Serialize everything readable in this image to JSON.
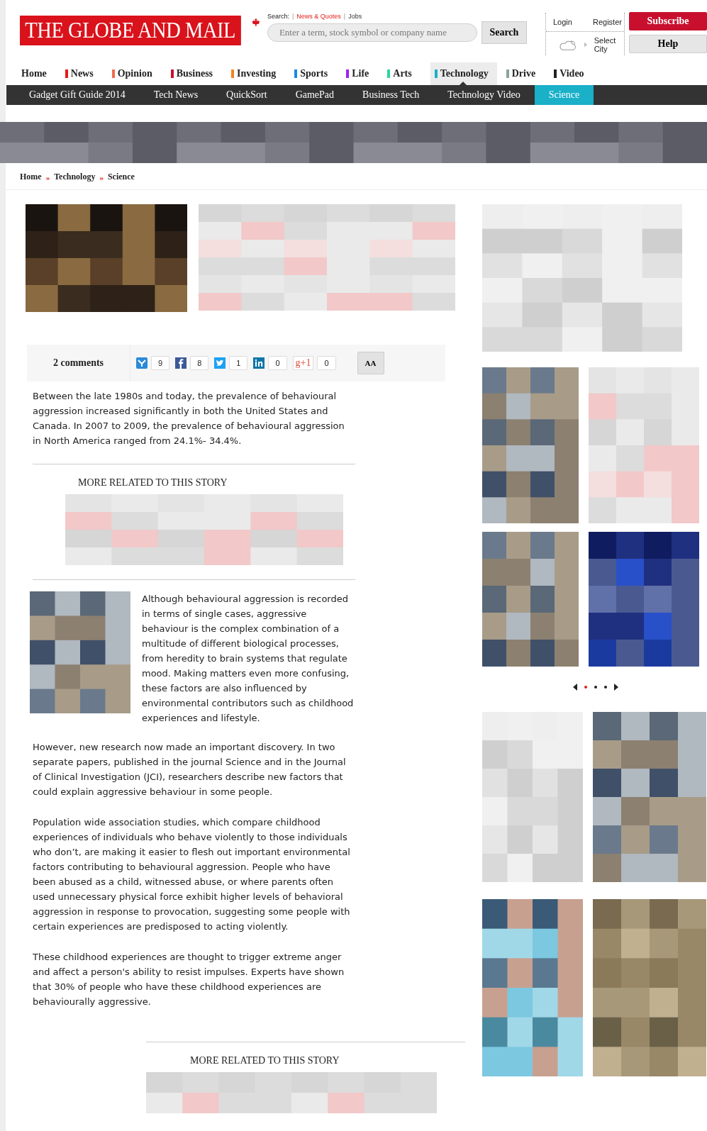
{
  "header": {
    "logo": "THE GLOBE AND MAIL",
    "search_label": "Search:",
    "search_links": [
      {
        "separator": "|",
        "label": "News & Quotes",
        "selected": true
      },
      {
        "separator": "|",
        "label": "Jobs",
        "selected": false
      }
    ],
    "search_field": {
      "placeholder": "Enter a term, stock symbol or company name"
    },
    "search_button": "Search",
    "login": "Login",
    "register": "Register",
    "city": "Select City",
    "subscribe": "Subscribe",
    "help": "Help"
  },
  "nav": [
    {
      "label": "Home",
      "selected": false
    },
    {
      "label": "News",
      "color": "#e41b17",
      "selected": false
    },
    {
      "label": "Opinion",
      "color": "#f26b4f",
      "selected": false
    },
    {
      "label": "Business",
      "color": "#c8102e",
      "selected": false
    },
    {
      "label": "Investing",
      "color": "#f58220",
      "selected": false
    },
    {
      "label": "Sports",
      "color": "#1e88e5",
      "selected": false
    },
    {
      "label": "Life",
      "color": "#a020f0",
      "selected": false
    },
    {
      "label": "Arts",
      "color": "#2ed3a0",
      "selected": false
    },
    {
      "label": "Technology",
      "color": "#1ab0c8",
      "selected": true
    },
    {
      "label": "Drive",
      "color": "#8aa59a",
      "selected": false
    },
    {
      "label": "Video",
      "color": "#222222",
      "selected": false
    }
  ],
  "subnav": [
    {
      "label": "Gadget Gift Guide 2014",
      "selected": false
    },
    {
      "label": "Tech News",
      "selected": false
    },
    {
      "label": "QuickSort",
      "selected": false
    },
    {
      "label": "GamePad",
      "selected": false
    },
    {
      "label": "Business Tech",
      "selected": false
    },
    {
      "label": "Technology Video",
      "selected": false
    },
    {
      "label": "Science",
      "selected": true
    }
  ],
  "breadcrumb": [
    {
      "label": "Home"
    },
    {
      "separator": "»",
      "label": "Technology"
    },
    {
      "separator": "»",
      "label": "Science"
    }
  ],
  "share_bar": {
    "comments": "2 comments",
    "buttons": [
      {
        "kind": "share",
        "count": "9"
      },
      {
        "kind": "facebook",
        "count": "8"
      },
      {
        "kind": "twitter",
        "count": "1"
      },
      {
        "kind": "linkedin",
        "count": "0"
      },
      {
        "kind": "gplus",
        "label": "g+1",
        "count": "0"
      }
    ],
    "font_button": "AA"
  },
  "article": {
    "intro": "Between the late 1980s and today, the prevalence of behavioural aggression increased significantly in both the United States and Canada. In 2007 to 2009, the prevalence of behavioural aggression in North America ranged from 24.1%- 34.4%.",
    "related_heading": "MORE RELATED TO THIS STORY",
    "paragraphs": [
      "Although behavioural aggression is recorded in terms of single cases, aggressive behaviour is the complex combination of a multitude of different biological processes, from heredity to brain systems that regulate mood. Making matters even more confusing, these factors are also influenced by environmental contributors such as childhood experiences and lifestyle.",
      "However, new research now made an important discovery. In two separate papers, published in the journal Science and in the Journal of Clinical Investigation (JCI), researchers describe new factors that could explain aggressive behaviour in some people.",
      "Population wide association studies, which compare childhood experiences of individuals who behave violently to those individuals who don’t, are making it easier to flesh out important environmental factors contributing to behavioural aggression. People who have been abused as a child, witnessed abuse, or where parents often used unnecessary physical force exhibit higher levels of behavioral aggression in response to provocation, suggesting some people with certain experiences are predisposed to acting violently.",
      "These childhood experiences are thought to trigger extreme anger and affect a person's ability to resist impulses. Experts have shown that 30% of people who have these childhood experiences are behaviourally aggressive."
    ],
    "related_heading_2": "MORE RELATED TO THIS STORY"
  },
  "carousel": {
    "dots": [
      {
        "selected": true
      },
      {
        "selected": false
      },
      {
        "selected": false
      }
    ]
  }
}
